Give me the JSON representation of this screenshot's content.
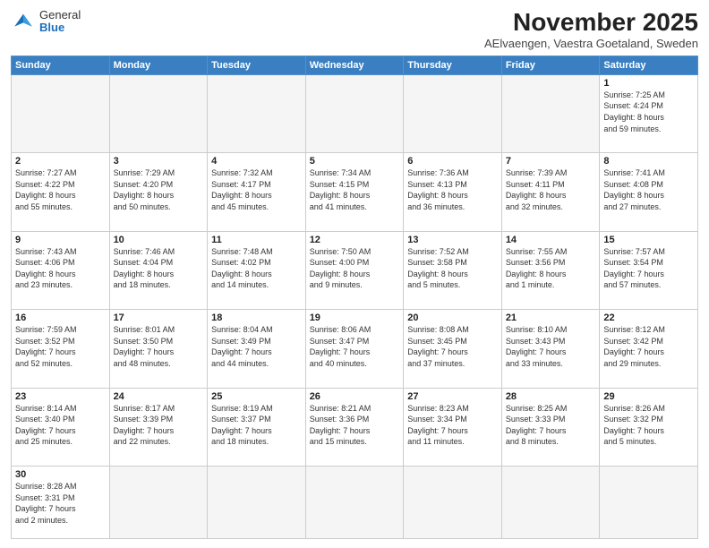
{
  "header": {
    "logo_line1": "General",
    "logo_line2": "Blue",
    "month": "November 2025",
    "location": "AElvaengen, Vaestra Goetaland, Sweden"
  },
  "days_of_week": [
    "Sunday",
    "Monday",
    "Tuesday",
    "Wednesday",
    "Thursday",
    "Friday",
    "Saturday"
  ],
  "weeks": [
    [
      {
        "num": "",
        "info": ""
      },
      {
        "num": "",
        "info": ""
      },
      {
        "num": "",
        "info": ""
      },
      {
        "num": "",
        "info": ""
      },
      {
        "num": "",
        "info": ""
      },
      {
        "num": "",
        "info": ""
      },
      {
        "num": "1",
        "info": "Sunrise: 7:25 AM\nSunset: 4:24 PM\nDaylight: 8 hours\nand 59 minutes."
      }
    ],
    [
      {
        "num": "2",
        "info": "Sunrise: 7:27 AM\nSunset: 4:22 PM\nDaylight: 8 hours\nand 55 minutes."
      },
      {
        "num": "3",
        "info": "Sunrise: 7:29 AM\nSunset: 4:20 PM\nDaylight: 8 hours\nand 50 minutes."
      },
      {
        "num": "4",
        "info": "Sunrise: 7:32 AM\nSunset: 4:17 PM\nDaylight: 8 hours\nand 45 minutes."
      },
      {
        "num": "5",
        "info": "Sunrise: 7:34 AM\nSunset: 4:15 PM\nDaylight: 8 hours\nand 41 minutes."
      },
      {
        "num": "6",
        "info": "Sunrise: 7:36 AM\nSunset: 4:13 PM\nDaylight: 8 hours\nand 36 minutes."
      },
      {
        "num": "7",
        "info": "Sunrise: 7:39 AM\nSunset: 4:11 PM\nDaylight: 8 hours\nand 32 minutes."
      },
      {
        "num": "8",
        "info": "Sunrise: 7:41 AM\nSunset: 4:08 PM\nDaylight: 8 hours\nand 27 minutes."
      }
    ],
    [
      {
        "num": "9",
        "info": "Sunrise: 7:43 AM\nSunset: 4:06 PM\nDaylight: 8 hours\nand 23 minutes."
      },
      {
        "num": "10",
        "info": "Sunrise: 7:46 AM\nSunset: 4:04 PM\nDaylight: 8 hours\nand 18 minutes."
      },
      {
        "num": "11",
        "info": "Sunrise: 7:48 AM\nSunset: 4:02 PM\nDaylight: 8 hours\nand 14 minutes."
      },
      {
        "num": "12",
        "info": "Sunrise: 7:50 AM\nSunset: 4:00 PM\nDaylight: 8 hours\nand 9 minutes."
      },
      {
        "num": "13",
        "info": "Sunrise: 7:52 AM\nSunset: 3:58 PM\nDaylight: 8 hours\nand 5 minutes."
      },
      {
        "num": "14",
        "info": "Sunrise: 7:55 AM\nSunset: 3:56 PM\nDaylight: 8 hours\nand 1 minute."
      },
      {
        "num": "15",
        "info": "Sunrise: 7:57 AM\nSunset: 3:54 PM\nDaylight: 7 hours\nand 57 minutes."
      }
    ],
    [
      {
        "num": "16",
        "info": "Sunrise: 7:59 AM\nSunset: 3:52 PM\nDaylight: 7 hours\nand 52 minutes."
      },
      {
        "num": "17",
        "info": "Sunrise: 8:01 AM\nSunset: 3:50 PM\nDaylight: 7 hours\nand 48 minutes."
      },
      {
        "num": "18",
        "info": "Sunrise: 8:04 AM\nSunset: 3:49 PM\nDaylight: 7 hours\nand 44 minutes."
      },
      {
        "num": "19",
        "info": "Sunrise: 8:06 AM\nSunset: 3:47 PM\nDaylight: 7 hours\nand 40 minutes."
      },
      {
        "num": "20",
        "info": "Sunrise: 8:08 AM\nSunset: 3:45 PM\nDaylight: 7 hours\nand 37 minutes."
      },
      {
        "num": "21",
        "info": "Sunrise: 8:10 AM\nSunset: 3:43 PM\nDaylight: 7 hours\nand 33 minutes."
      },
      {
        "num": "22",
        "info": "Sunrise: 8:12 AM\nSunset: 3:42 PM\nDaylight: 7 hours\nand 29 minutes."
      }
    ],
    [
      {
        "num": "23",
        "info": "Sunrise: 8:14 AM\nSunset: 3:40 PM\nDaylight: 7 hours\nand 25 minutes."
      },
      {
        "num": "24",
        "info": "Sunrise: 8:17 AM\nSunset: 3:39 PM\nDaylight: 7 hours\nand 22 minutes."
      },
      {
        "num": "25",
        "info": "Sunrise: 8:19 AM\nSunset: 3:37 PM\nDaylight: 7 hours\nand 18 minutes."
      },
      {
        "num": "26",
        "info": "Sunrise: 8:21 AM\nSunset: 3:36 PM\nDaylight: 7 hours\nand 15 minutes."
      },
      {
        "num": "27",
        "info": "Sunrise: 8:23 AM\nSunset: 3:34 PM\nDaylight: 7 hours\nand 11 minutes."
      },
      {
        "num": "28",
        "info": "Sunrise: 8:25 AM\nSunset: 3:33 PM\nDaylight: 7 hours\nand 8 minutes."
      },
      {
        "num": "29",
        "info": "Sunrise: 8:26 AM\nSunset: 3:32 PM\nDaylight: 7 hours\nand 5 minutes."
      }
    ],
    [
      {
        "num": "30",
        "info": "Sunrise: 8:28 AM\nSunset: 3:31 PM\nDaylight: 7 hours\nand 2 minutes."
      },
      {
        "num": "",
        "info": ""
      },
      {
        "num": "",
        "info": ""
      },
      {
        "num": "",
        "info": ""
      },
      {
        "num": "",
        "info": ""
      },
      {
        "num": "",
        "info": ""
      },
      {
        "num": "",
        "info": ""
      }
    ]
  ]
}
